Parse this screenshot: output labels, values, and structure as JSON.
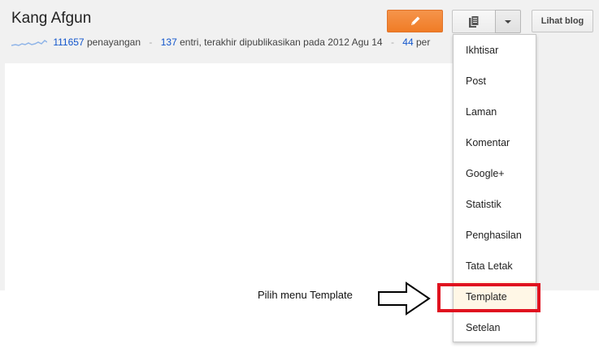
{
  "blog": {
    "title": "Kang Afgun",
    "views_count": "111657",
    "views_label": "penayangan",
    "entries_count": "137",
    "entries_label": "entri, terakhir dipublikasikan pada 2012 Agu 14",
    "third_count": "44",
    "third_label": "per"
  },
  "toolbar": {
    "edit_icon": "pencil-icon",
    "pages_icon": "pages-icon",
    "dropdown_icon": "caret-down-icon",
    "view_blog_label": "Lihat blog",
    "accent_color": "#f07c26"
  },
  "menu": {
    "items": [
      {
        "label": "Ikhtisar"
      },
      {
        "label": "Post"
      },
      {
        "label": "Laman"
      },
      {
        "label": "Komentar"
      },
      {
        "label": "Google+"
      },
      {
        "label": "Statistik"
      },
      {
        "label": "Penghasilan"
      },
      {
        "label": "Tata Letak"
      },
      {
        "label": "Template"
      },
      {
        "label": "Setelan"
      }
    ],
    "highlighted": "Template",
    "highlight_color": "#e0121f"
  },
  "annotation": {
    "text": "Pilih menu Template"
  }
}
